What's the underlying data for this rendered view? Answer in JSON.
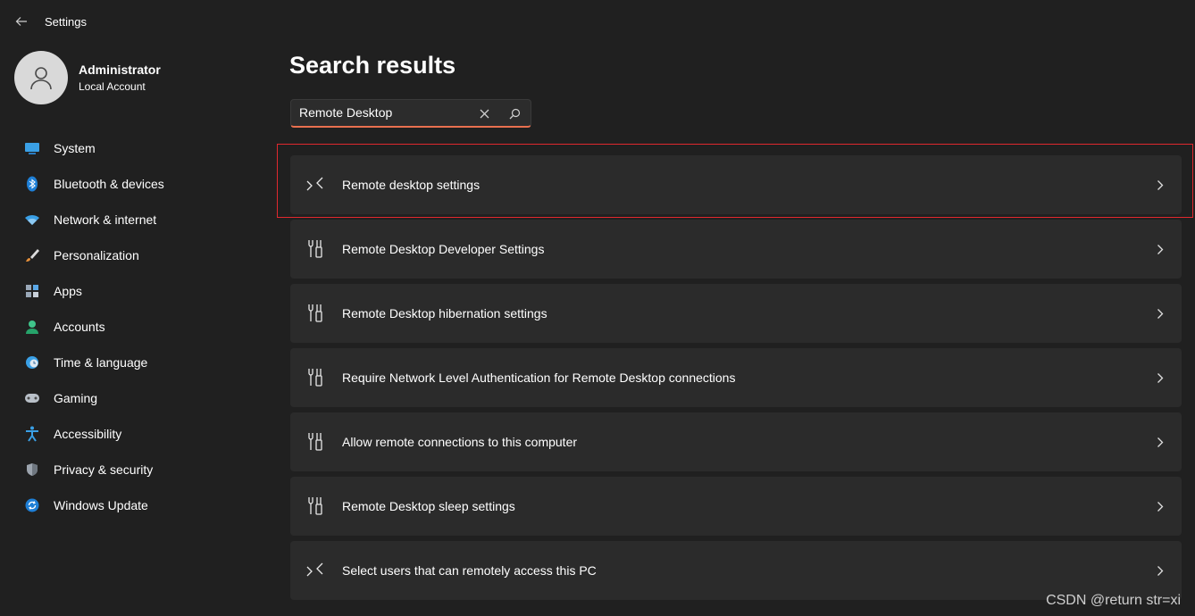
{
  "app": {
    "title": "Settings"
  },
  "profile": {
    "name": "Administrator",
    "account_type": "Local Account"
  },
  "sidebar": {
    "items": [
      {
        "label": "System",
        "icon": "monitor-icon"
      },
      {
        "label": "Bluetooth & devices",
        "icon": "bluetooth-icon"
      },
      {
        "label": "Network & internet",
        "icon": "wifi-icon"
      },
      {
        "label": "Personalization",
        "icon": "brush-icon"
      },
      {
        "label": "Apps",
        "icon": "apps-icon"
      },
      {
        "label": "Accounts",
        "icon": "person-icon"
      },
      {
        "label": "Time & language",
        "icon": "clock-globe-icon"
      },
      {
        "label": "Gaming",
        "icon": "gamepad-icon"
      },
      {
        "label": "Accessibility",
        "icon": "accessibility-icon"
      },
      {
        "label": "Privacy & security",
        "icon": "shield-icon"
      },
      {
        "label": "Windows Update",
        "icon": "update-icon"
      }
    ]
  },
  "main": {
    "title": "Search results",
    "search": {
      "value": "Remote Desktop"
    },
    "results": [
      {
        "label": "Remote desktop settings",
        "icon": "remote-desktop-icon"
      },
      {
        "label": "Remote Desktop Developer Settings",
        "icon": "tools-icon"
      },
      {
        "label": "Remote Desktop hibernation settings",
        "icon": "tools-icon"
      },
      {
        "label": "Require Network Level Authentication for Remote Desktop connections",
        "icon": "tools-icon"
      },
      {
        "label": "Allow remote connections to this computer",
        "icon": "tools-icon"
      },
      {
        "label": "Remote Desktop sleep settings",
        "icon": "tools-icon"
      },
      {
        "label": "Select users that can remotely access this PC",
        "icon": "remote-desktop-icon"
      }
    ]
  },
  "watermark": "CSDN @return str=xi",
  "colors": {
    "background": "#202020",
    "card": "#2b2b2b",
    "accent": "#e9704f",
    "highlight": "#e0282e"
  }
}
